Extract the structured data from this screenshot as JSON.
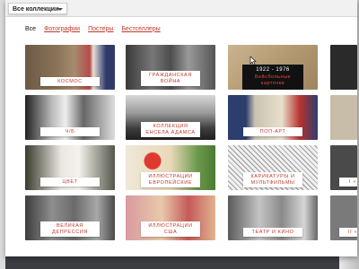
{
  "header": {
    "collection_select": "Все коллекции"
  },
  "tabs": [
    {
      "label": "Все"
    },
    {
      "label": "Фотографии"
    },
    {
      "label": "Постеры"
    },
    {
      "label": "Бестселлеры"
    }
  ],
  "tiles": [
    {
      "label": "Космос"
    },
    {
      "label": "Гражданская война"
    },
    {
      "label": "1922 - 1976",
      "title": "Бейсбольные карточки"
    },
    {
      "label": ""
    },
    {
      "label": "Ч/Б"
    },
    {
      "label": "Коллекция Енсела Адамса"
    },
    {
      "label": "Поп-арт"
    },
    {
      "label": ""
    },
    {
      "label": "Цвет"
    },
    {
      "label": "Иллюстрации европейские"
    },
    {
      "label": "Карикатуры и мультфильмы"
    },
    {
      "label": "I «"
    },
    {
      "label": "Великая депрессия"
    },
    {
      "label": "Иллюстрации США"
    },
    {
      "label": "Театр и кино"
    },
    {
      "label": "II «"
    }
  ],
  "colors": {
    "accent": "#c0392b",
    "background": "#3b3d42",
    "window": "#ffffff"
  }
}
